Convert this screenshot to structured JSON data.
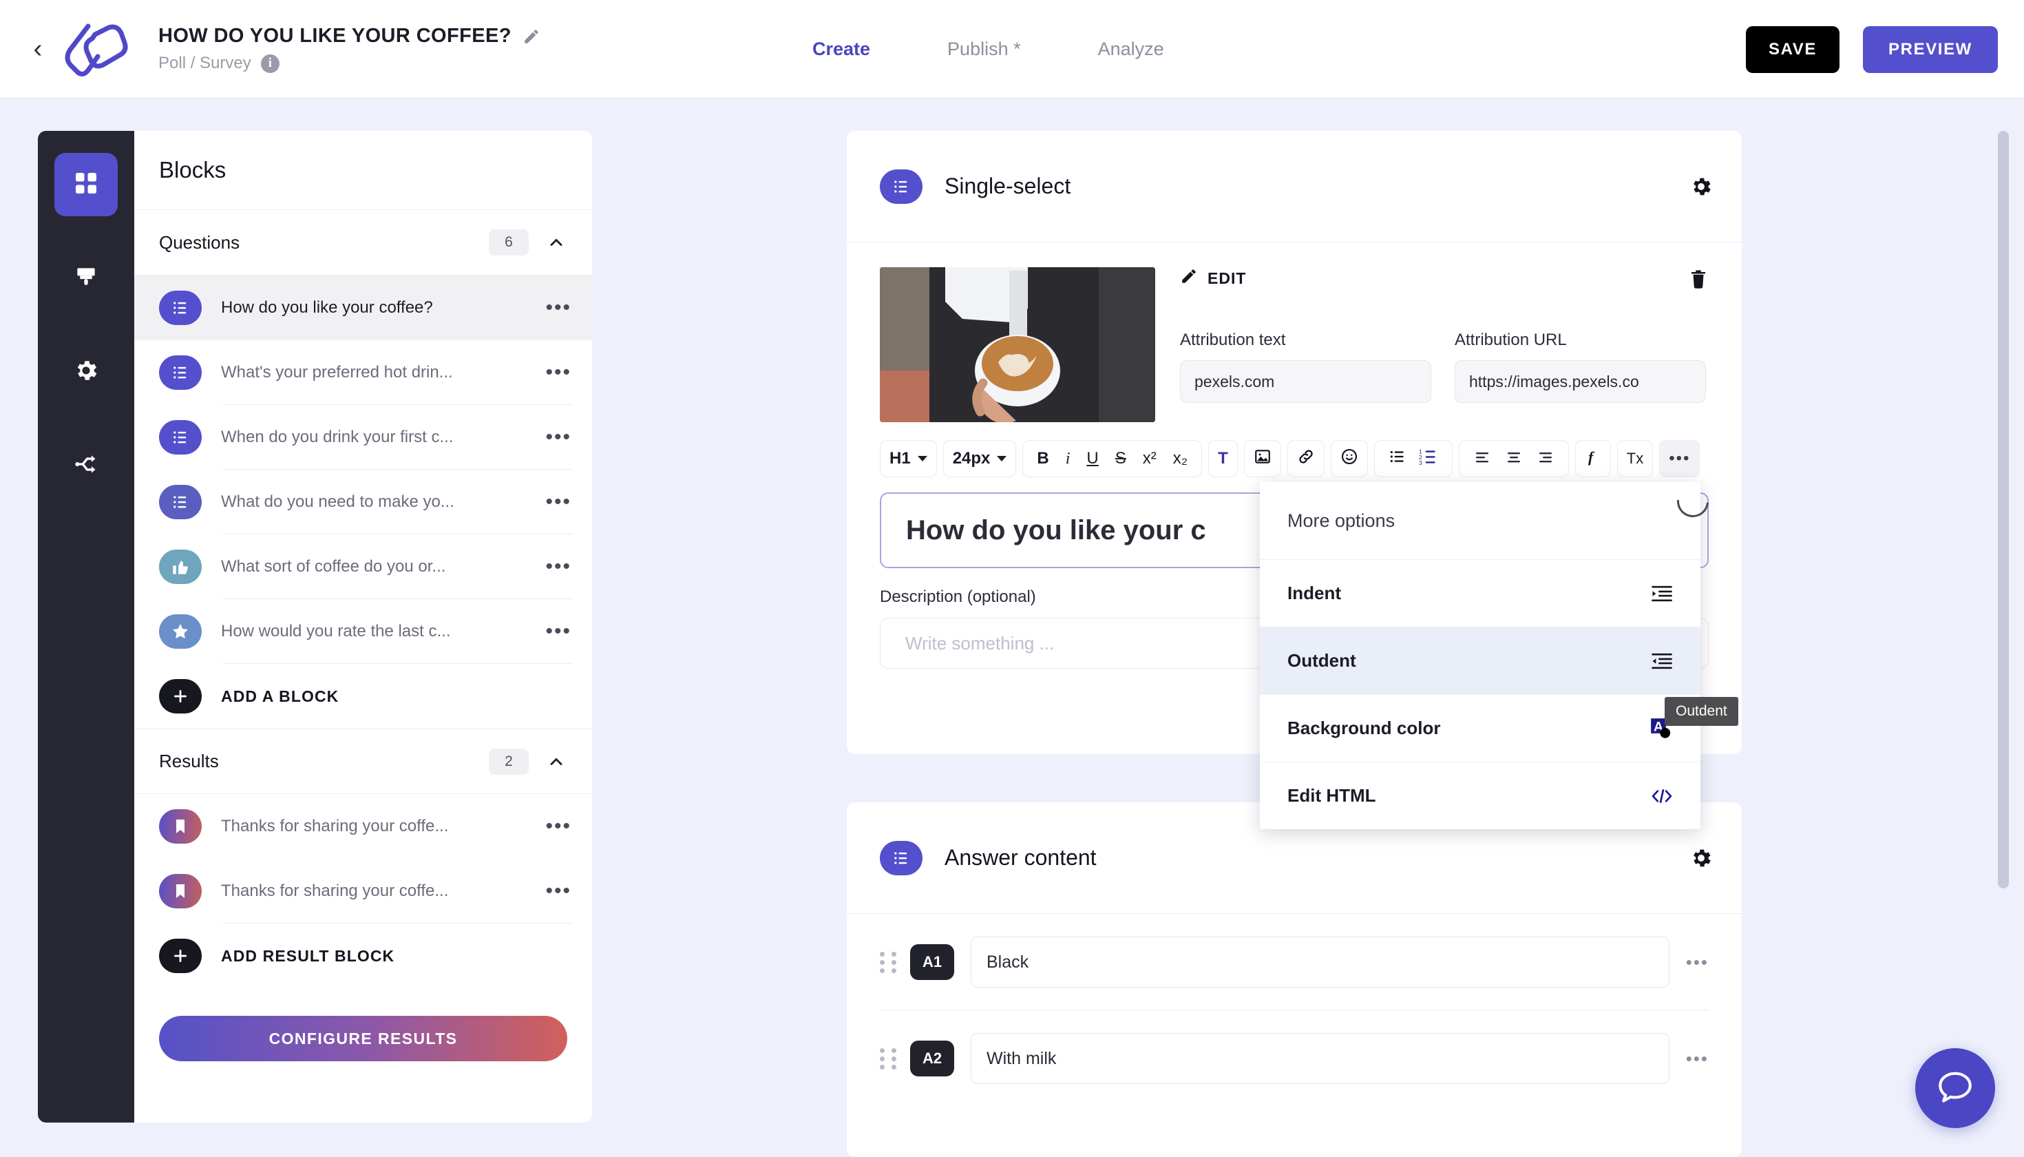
{
  "header": {
    "back_icon": "chevron-left-icon",
    "logo": "brand-logo",
    "doc_title": "HOW DO YOU LIKE YOUR COFFEE?",
    "edit_title_icon": "pencil-icon",
    "doc_subtitle": "Poll / Survey",
    "info_icon": "info-icon",
    "info_glyph": "i",
    "tabs": [
      {
        "label": "Create",
        "active": true
      },
      {
        "label": "Publish *",
        "active": false
      },
      {
        "label": "Analyze",
        "active": false
      }
    ],
    "save_label": "SAVE",
    "preview_label": "PREVIEW",
    "accent_color": "#544fcd",
    "save_color": "#000000"
  },
  "rail": {
    "items": [
      {
        "icon": "grid-blocks-icon",
        "active": true
      },
      {
        "icon": "paint-brush-icon",
        "active": false
      },
      {
        "icon": "gear-icon",
        "active": false
      },
      {
        "icon": "share-nodes-icon",
        "active": false
      }
    ]
  },
  "blocks_panel": {
    "title": "Blocks",
    "questions_section": {
      "label": "Questions",
      "count": "6",
      "collapse_icon": "chevron-up-icon",
      "items": [
        {
          "label": "How do you like your coffee?",
          "icon": "list-icon",
          "color": "#544fcd",
          "selected": true
        },
        {
          "label": "What's your preferred hot drin...",
          "icon": "list-icon",
          "color": "#544fcd",
          "selected": false
        },
        {
          "label": "When do you drink your first c...",
          "icon": "list-icon",
          "color": "#544fcd",
          "selected": false
        },
        {
          "label": "What do you need to make yo...",
          "icon": "list-bullets-icon",
          "color": "#5a5ec0",
          "selected": false
        },
        {
          "label": "What sort of coffee do you or...",
          "icon": "thumbs-up-icon",
          "color": "#6fa5bd",
          "selected": false
        },
        {
          "label": "How would you rate the last c...",
          "icon": "star-icon",
          "color": "#6b8fc9",
          "selected": false
        }
      ],
      "add_label": "ADD A BLOCK",
      "add_icon": "plus-icon"
    },
    "results_section": {
      "label": "Results",
      "count": "2",
      "collapse_icon": "chevron-up-icon",
      "items": [
        {
          "label": "Thanks for sharing your coffe...",
          "icon": "bookmark-icon"
        },
        {
          "label": "Thanks for sharing your coffe...",
          "icon": "bookmark-icon"
        }
      ],
      "add_label": "ADD RESULT BLOCK",
      "add_icon": "plus-icon"
    },
    "configure_label": "CONFIGURE RESULTS",
    "kebab_glyph": "•••"
  },
  "question_card": {
    "icon": "list-icon",
    "title": "Single-select",
    "gear_icon": "gear-icon",
    "media": {
      "image_alt": "barista pouring latte art into a white cup",
      "edit_label": "EDIT",
      "edit_icon": "pencil-icon",
      "delete_icon": "trash-icon",
      "attribution_text_label": "Attribution text",
      "attribution_text_value": "pexels.com",
      "attribution_url_label": "Attribution URL",
      "attribution_url_value": "https://images.pexels.co"
    },
    "toolbar": {
      "heading_value": "H1",
      "fontsize_value": "24px",
      "bold": "B",
      "italic": "i",
      "underline": "U",
      "strikethrough": "S",
      "superscript": "x²",
      "subscript": "x₂",
      "text_color_glyph": "T",
      "image_icon": "image-icon",
      "link_icon": "link-icon",
      "emoji_icon": "emoji-smiley-icon",
      "bullet_list_icon": "bullet-list-icon",
      "numbered_list_icon": "numbered-list-icon",
      "align_left_icon": "align-left-icon",
      "align_center_icon": "align-center-icon",
      "align_right_icon": "align-right-icon",
      "formula_icon": "formula-icon",
      "clear_format_glyph": "Tx",
      "more_glyph": "•••"
    },
    "title_value": "How do you like your c",
    "description_label": "Description (optional)",
    "description_placeholder": "Write something ..."
  },
  "answer_card": {
    "icon": "list-icon",
    "title": "Answer content",
    "gear_icon": "gear-icon",
    "rows": [
      {
        "tag": "A1",
        "value": "Black",
        "drag_icon": "drag-handle-icon",
        "kebab": "•••"
      },
      {
        "tag": "A2",
        "value": "With milk",
        "drag_icon": "drag-handle-icon",
        "kebab": "•••"
      }
    ]
  },
  "dropdown": {
    "heading": "More options",
    "items": [
      {
        "label": "Indent",
        "icon": "indent-icon",
        "hover": false
      },
      {
        "label": "Outdent",
        "icon": "outdent-icon",
        "hover": true
      },
      {
        "label": "Background color",
        "icon": "background-color-icon",
        "hover": false
      },
      {
        "label": "Edit HTML",
        "icon": "code-brackets-icon",
        "hover": false
      }
    ]
  },
  "tooltip": {
    "text": "Outdent"
  },
  "chat_fab": {
    "icon": "chat-bubble-icon"
  }
}
